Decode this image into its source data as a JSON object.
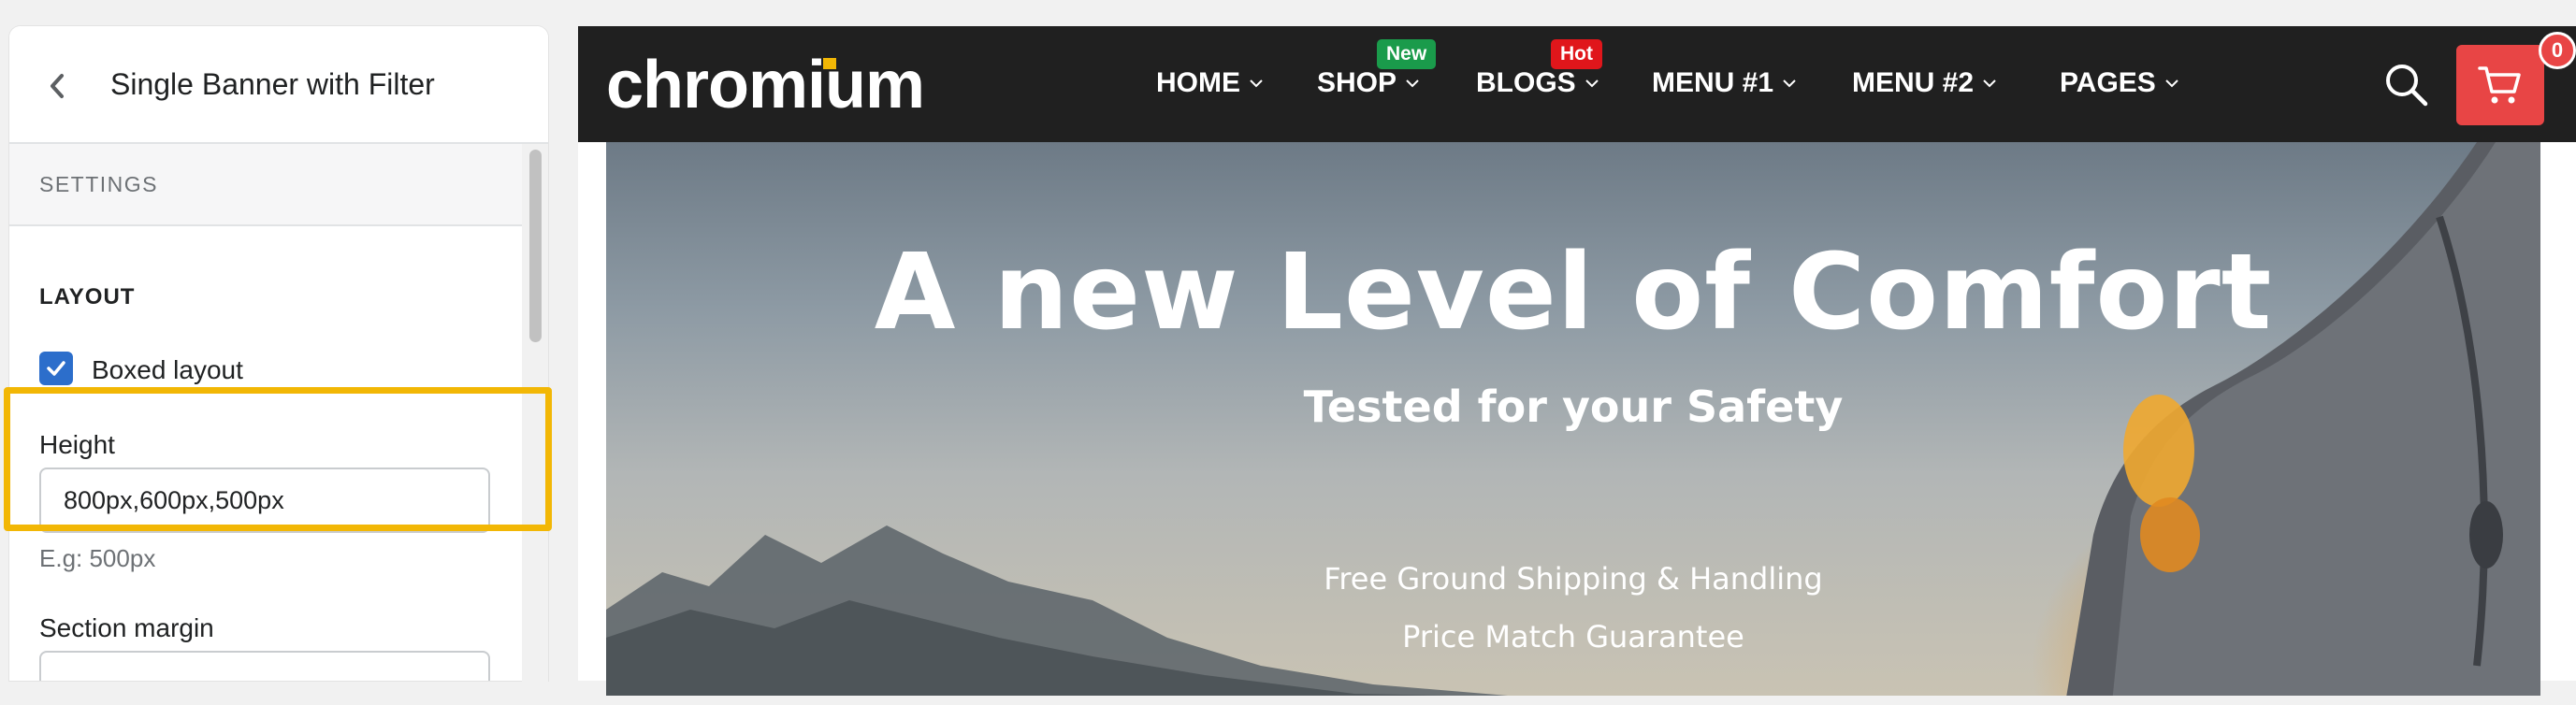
{
  "editor": {
    "title": "Single Banner with Filter",
    "section_header": "SETTINGS",
    "layout_heading": "LAYOUT",
    "boxed_layout": {
      "label": "Boxed layout",
      "checked": true
    },
    "height": {
      "label": "Height",
      "value": "800px,600px,500px",
      "help": "E.g: 500px"
    },
    "section_margin": {
      "label": "Section margin",
      "value": ""
    },
    "highlight_color": "#f2b705",
    "accent_color": "#2c6ecb"
  },
  "store": {
    "logo": "chromium",
    "nav": [
      {
        "label": "HOME"
      },
      {
        "label": "SHOP",
        "badge": "New",
        "badge_color": "#1a9b4b"
      },
      {
        "label": "BLOGS",
        "badge": "Hot",
        "badge_color": "#e0161b"
      },
      {
        "label": "MENU #1"
      },
      {
        "label": "MENU #2"
      },
      {
        "label": "PAGES"
      }
    ],
    "cart_count": "0",
    "cart_color": "#e84545",
    "icons": [
      "search-icon",
      "cart-icon",
      "chevron-down-icon"
    ]
  },
  "hero": {
    "title": "A new Level of Comfort",
    "subtitle": "Tested for your Safety",
    "features": [
      "Free Ground Shipping & Handling",
      "Price Match Guarantee"
    ]
  }
}
